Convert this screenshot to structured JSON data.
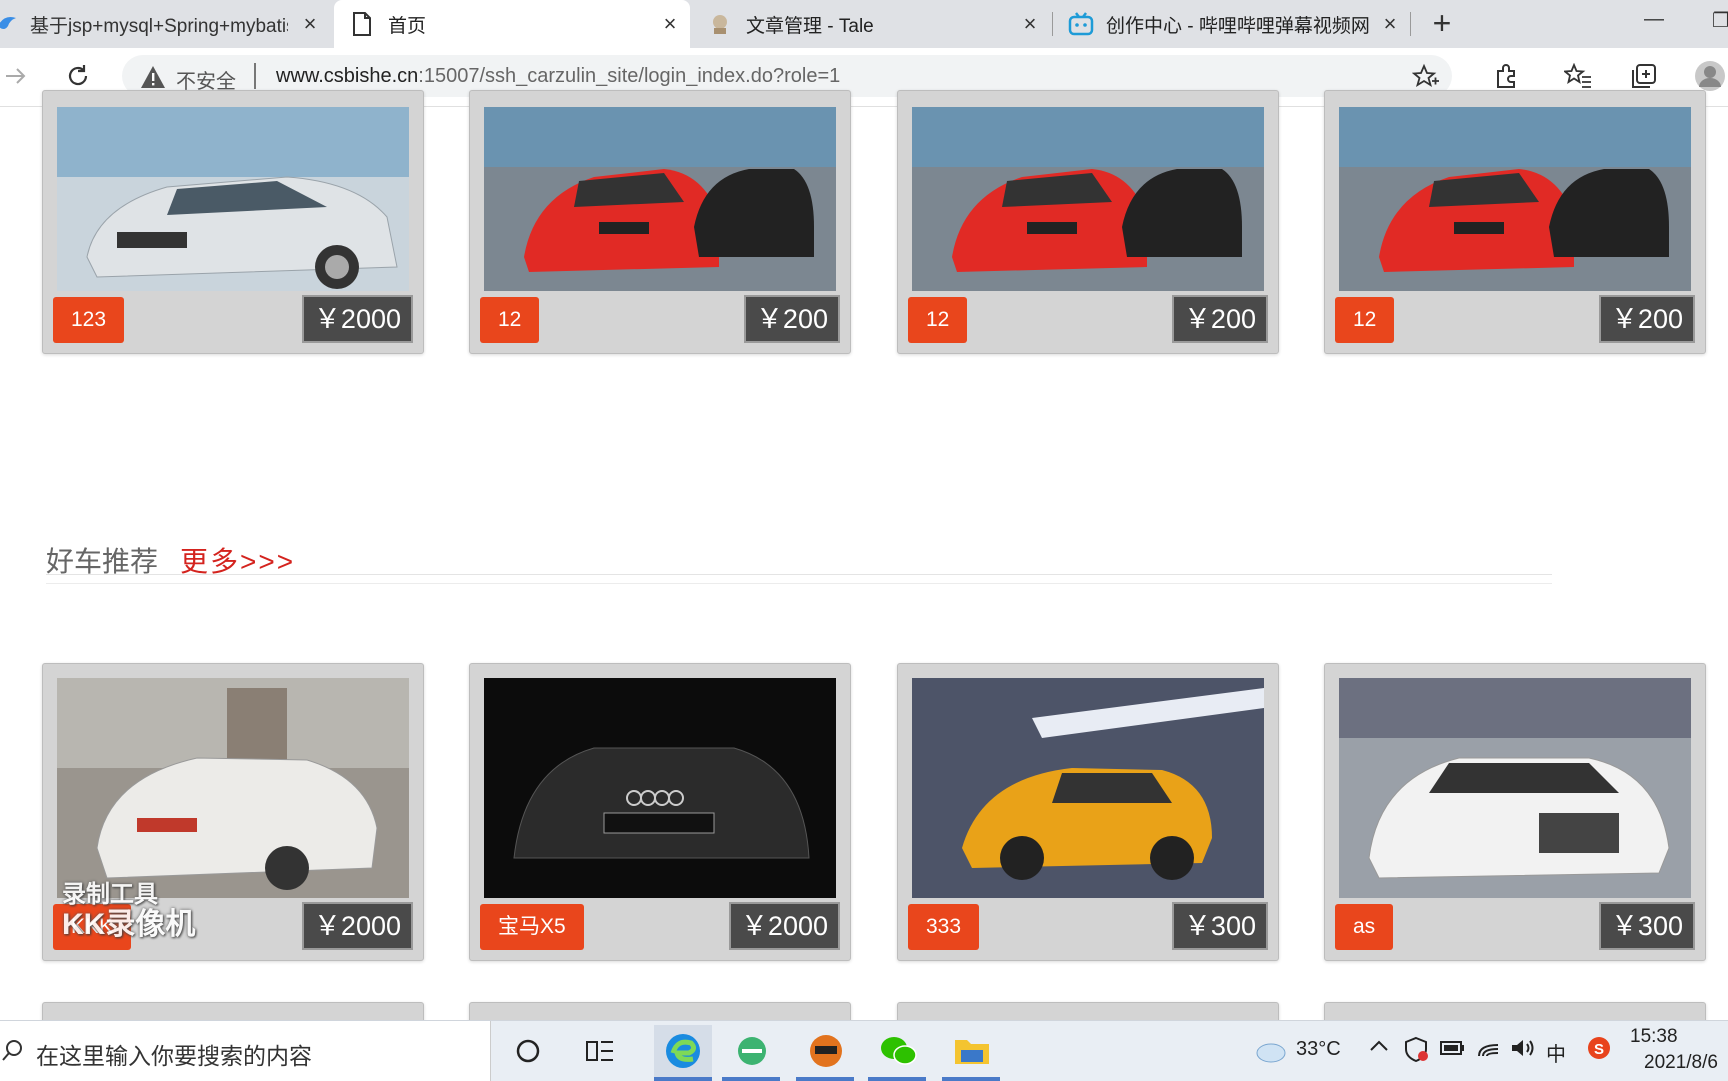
{
  "browser": {
    "tabs": [
      {
        "title": "基于jsp+mysql+Spring+mybatis",
        "active": false
      },
      {
        "title": "首页",
        "active": true
      },
      {
        "title": "文章管理 - Tale",
        "active": false
      },
      {
        "title": "创作中心 - 哔哩哔哩弹幕视频网",
        "active": false
      }
    ],
    "new_tab_label": "+",
    "security_label": "不安全",
    "url_host": "www.csbishe.cn",
    "url_rest": ":15007/ssh_carzulin_site/login_index.do?role=1"
  },
  "top_row": {
    "cards": [
      {
        "name": "123",
        "price": "￥2000",
        "image": "silver-kia-k5"
      },
      {
        "name": "12",
        "price": "￥200",
        "image": "red-bmw"
      },
      {
        "name": "12",
        "price": "￥200",
        "image": "red-bmw"
      },
      {
        "name": "12",
        "price": "￥200",
        "image": "red-bmw"
      }
    ]
  },
  "section": {
    "title": "好车推荐",
    "more_label": "更多>>>"
  },
  "bottom_row": {
    "cards": [
      {
        "name": "KKK",
        "price": "￥2000",
        "image": "white-chevrolet"
      },
      {
        "name": "宝马X5",
        "price": "￥2000",
        "image": "black-audi-tt"
      },
      {
        "name": "333",
        "price": "￥300",
        "image": "yellow-audi-tt"
      },
      {
        "name": "as",
        "price": "￥300",
        "image": "white-audi-a8"
      }
    ]
  },
  "watermark": {
    "line1": "录制工具",
    "line2": "KK录像机"
  },
  "taskbar": {
    "search_placeholder": "在这里输入你要搜索的内容",
    "weather": "33°C",
    "ime": "中",
    "time": "15:38",
    "date": "2021/8/6"
  },
  "colors": {
    "name_badge": "#e9461c",
    "price_badge": "#4a4a4a",
    "more_link": "#d4231e",
    "card_bg": "#d4d4d4"
  }
}
